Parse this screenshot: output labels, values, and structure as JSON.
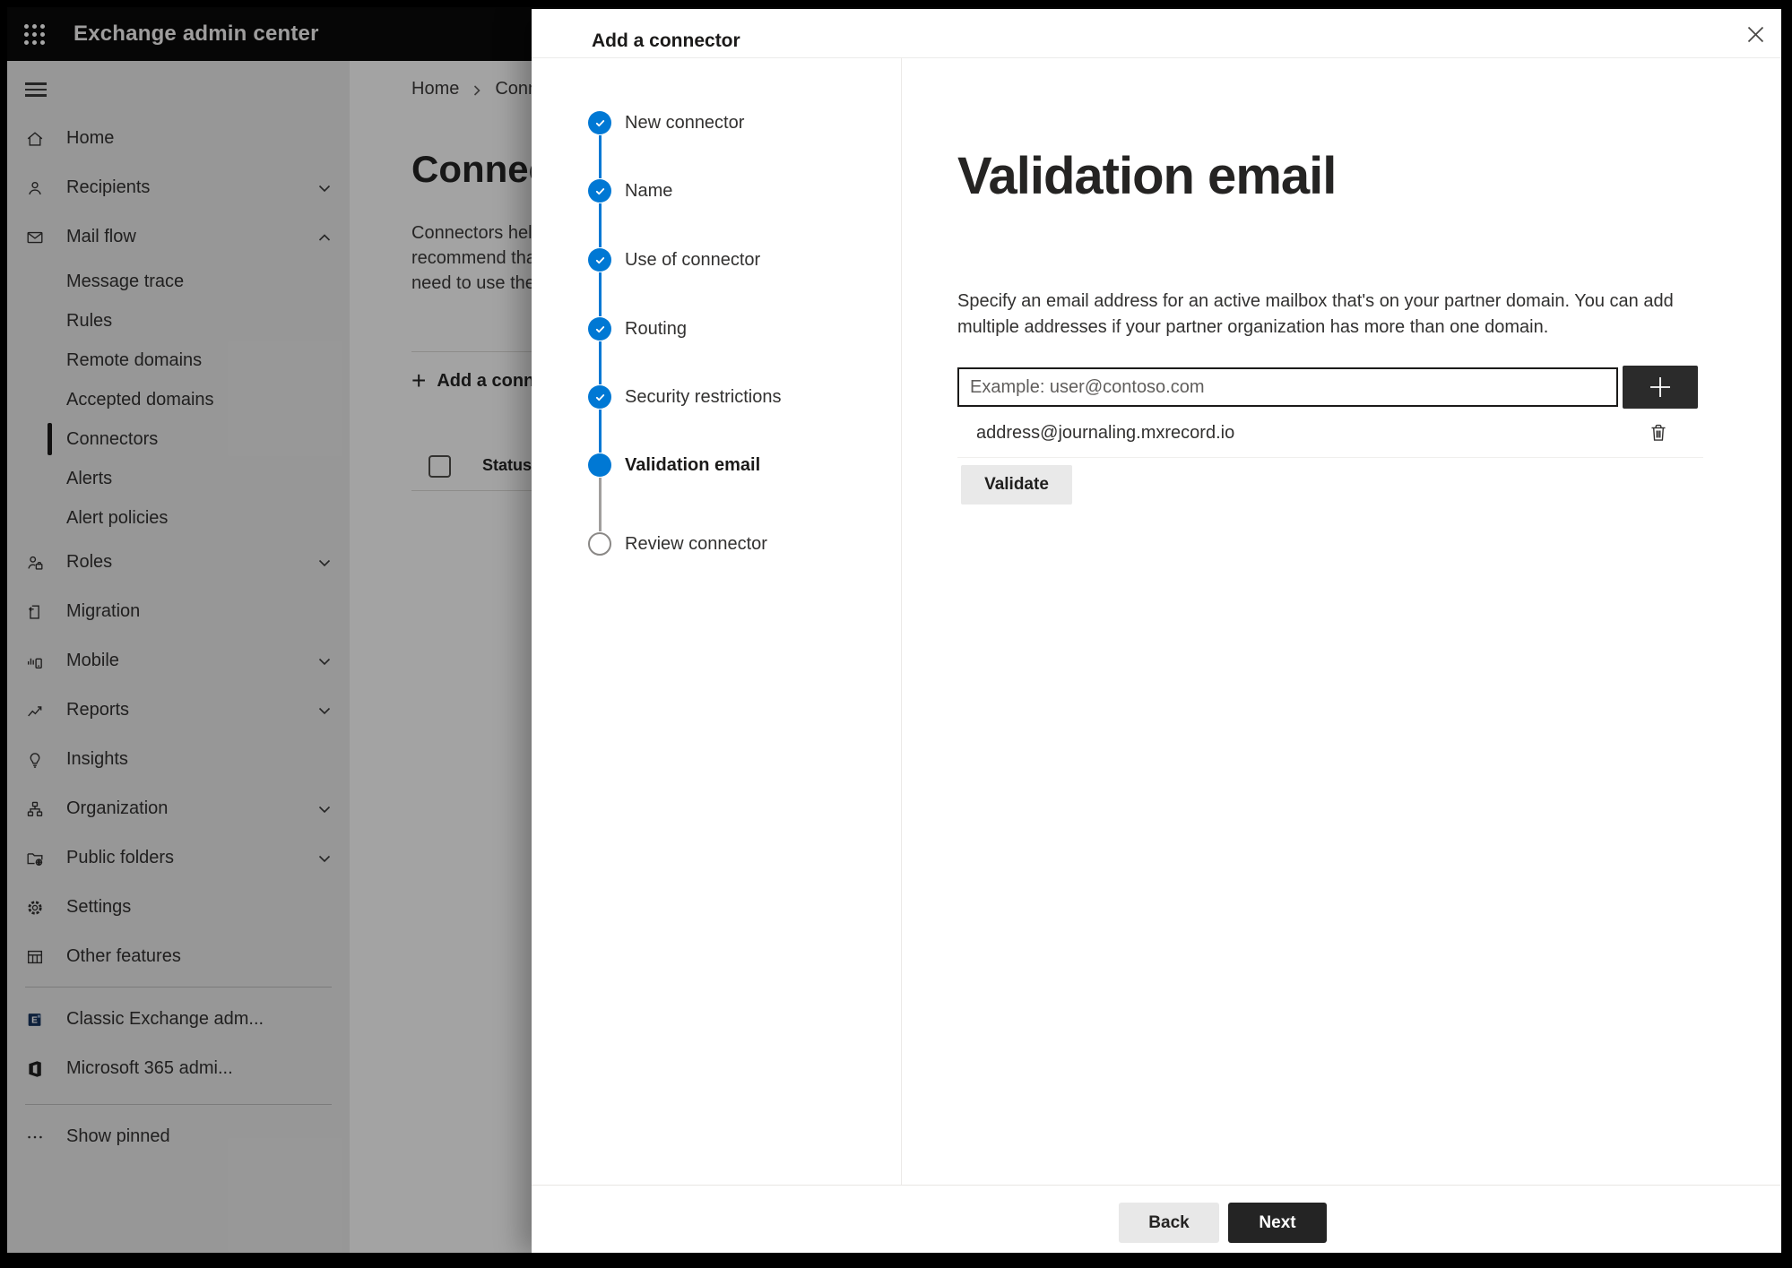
{
  "topbar": {
    "title": "Exchange admin center"
  },
  "sidebar": {
    "items": [
      {
        "icon": "home-icon",
        "label": "Home"
      },
      {
        "icon": "recipients-icon",
        "label": "Recipients",
        "chevron": "down"
      },
      {
        "icon": "mail-flow-icon",
        "label": "Mail flow",
        "chevron": "up"
      },
      {
        "label": "Message trace",
        "sub": true
      },
      {
        "label": "Rules",
        "sub": true
      },
      {
        "label": "Remote domains",
        "sub": true
      },
      {
        "label": "Accepted domains",
        "sub": true
      },
      {
        "label": "Connectors",
        "sub": true,
        "selected": true
      },
      {
        "label": "Alerts",
        "sub": true
      },
      {
        "label": "Alert policies",
        "sub": true
      },
      {
        "icon": "roles-icon",
        "label": "Roles",
        "chevron": "down"
      },
      {
        "icon": "migration-icon",
        "label": "Migration"
      },
      {
        "icon": "mobile-icon",
        "label": "Mobile",
        "chevron": "down"
      },
      {
        "icon": "reports-icon",
        "label": "Reports",
        "chevron": "down"
      },
      {
        "icon": "insights-icon",
        "label": "Insights"
      },
      {
        "icon": "organization-icon",
        "label": "Organization",
        "chevron": "down"
      },
      {
        "icon": "public-folders-icon",
        "label": "Public folders",
        "chevron": "down"
      },
      {
        "icon": "settings-icon",
        "label": "Settings"
      },
      {
        "icon": "other-features-icon",
        "label": "Other features"
      },
      {
        "divider": true
      },
      {
        "icon": "classic-exchange-icon",
        "label": "Classic Exchange adm..."
      },
      {
        "icon": "microsoft-365-icon",
        "label": "Microsoft 365 admi..."
      },
      {
        "divider": true,
        "second": true
      },
      {
        "icon": "more-icon",
        "label": "Show pinned"
      }
    ]
  },
  "background_page": {
    "breadcrumb": {
      "home": "Home",
      "current": "Conne"
    },
    "heading": "Connec",
    "intro_lines": [
      "Connectors help",
      "recommend that",
      "need to use ther"
    ],
    "add_connector_button": "Add a conn",
    "status_column": "Status"
  },
  "dialog": {
    "title": "Add a connector",
    "steps": [
      {
        "label": "New connector",
        "state": "completed"
      },
      {
        "label": "Name",
        "state": "completed"
      },
      {
        "label": "Use of connector",
        "state": "completed"
      },
      {
        "label": "Routing",
        "state": "completed"
      },
      {
        "label": "Security restrictions",
        "state": "completed"
      },
      {
        "label": "Validation email",
        "state": "current"
      },
      {
        "label": "Review connector",
        "state": "upcoming"
      }
    ],
    "content": {
      "heading": "Validation email",
      "description": "Specify an email address for an active mailbox that's on your partner domain. You can add multiple addresses if your partner organization has more than one domain.",
      "email_input_value": "",
      "email_placeholder": "Example: user@contoso.com",
      "emails": [
        "address@journaling.mxrecord.io"
      ],
      "validate_button": "Validate"
    },
    "footer": {
      "back_button": "Back",
      "next_button": "Next"
    }
  },
  "colors": {
    "accent_blue": "#0078d4",
    "topbar_bg": "#0a0a0a",
    "next_button_bg": "#242424",
    "add_email_button_bg": "#2b2b2b",
    "input_border": "#1b1a19",
    "upcoming_step_border": "#8a8886",
    "overlay": "rgba(0,0,0,0.35)"
  }
}
